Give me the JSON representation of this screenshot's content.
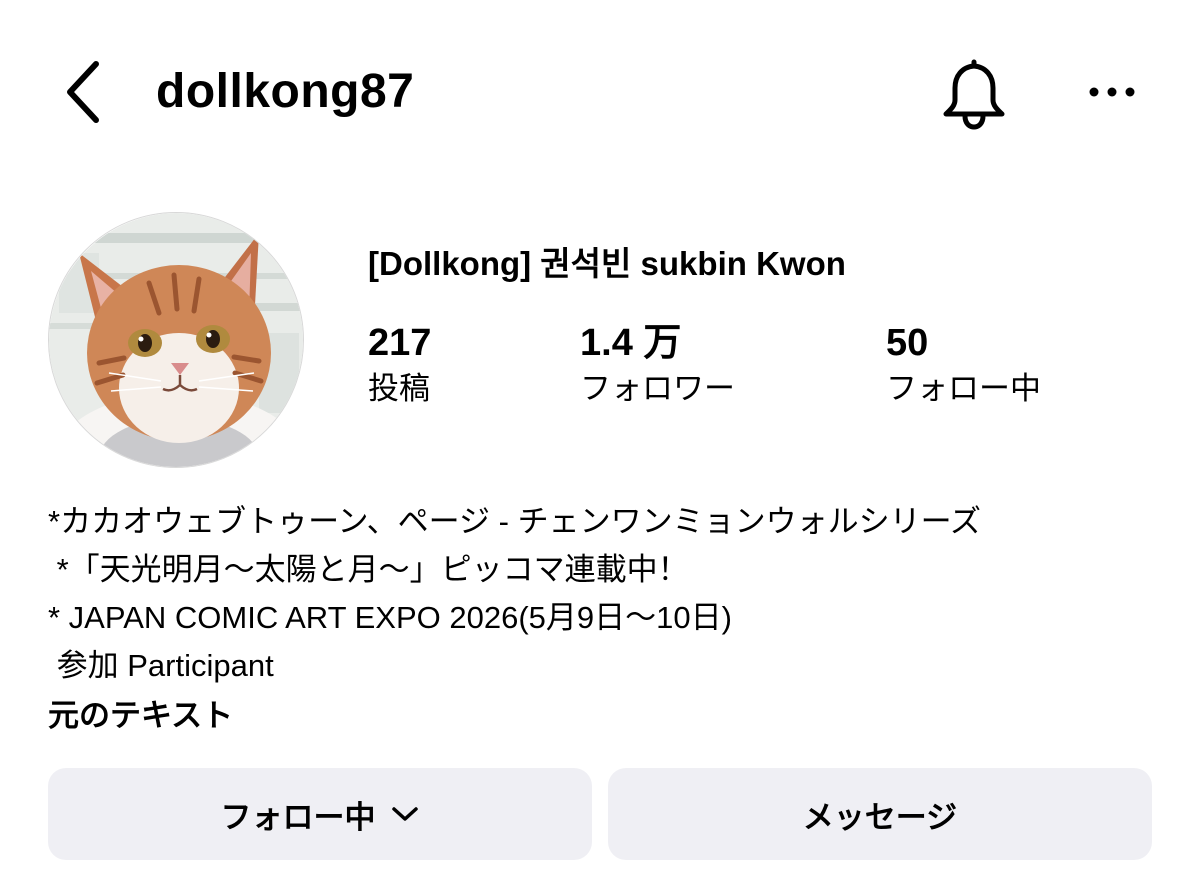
{
  "header": {
    "username": "dollkong87",
    "back_icon": "chevron-left-icon",
    "bell_icon": "bell-icon",
    "more_icon": "more-horizontal-icon"
  },
  "profile": {
    "display_name": "[Dollkong] 권석빈 sukbin Kwon",
    "avatar_description": "watercolor-cat-avatar",
    "stats": {
      "posts": {
        "value": "217",
        "label": "投稿"
      },
      "followers": {
        "value": "1.4 万",
        "label": "フォロワー"
      },
      "following": {
        "value": "50",
        "label": "フォロー中"
      }
    }
  },
  "bio": {
    "lines": [
      "*カカオウェブトゥーン、ページ - チェンワンミョンウォルシリーズ",
      " *「天光明月～太陽と月～」ピッコマ連載中！",
      "* JAPAN COMIC ART EXPO 2026(5月9日～10日)",
      " 参加 Participant"
    ],
    "translate_label": "元のテキスト"
  },
  "actions": {
    "following_label": "フォロー中",
    "following_icon": "chevron-down-icon",
    "message_label": "メッセージ",
    "button_bg": "#efeff4"
  }
}
